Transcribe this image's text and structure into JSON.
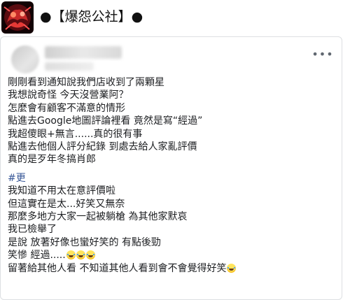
{
  "page": {
    "channel_title": "●【爆怨公社】●"
  },
  "post": {
    "more_menu_label": "•••",
    "paragraph1": [
      "剛剛看到通知說我們店收到了兩顆星",
      "我想說奇怪 今天沒營業阿？",
      "怎麼會有顧客不滿意的情形",
      "點進去Google地圖評論裡看 竟然是寫“經過”",
      "我超傻眼+無言......真的很有事",
      "點進去他個人評分紀錄 到處去給人家亂評價",
      "真的是歹年冬搞肖郎"
    ],
    "hashtag": "#更",
    "paragraph2": [
      "我知道不用太在意評價啦",
      "但這實在是太...好笑又無奈",
      "那麼多地方大家一起被躺槍 為其他家默哀",
      "我已檢舉了",
      "是說 放著好像也蠻好笑的 有點後勁"
    ],
    "laugh_line_text": "笑慘 經過.....",
    "last_line_text": "留著給其他人看 不知道其他人看到會不會覺得好笑",
    "emoji_names": [
      "joy-emoji",
      "joy-emoji",
      "joy-emoji",
      "joy-emoji"
    ]
  }
}
